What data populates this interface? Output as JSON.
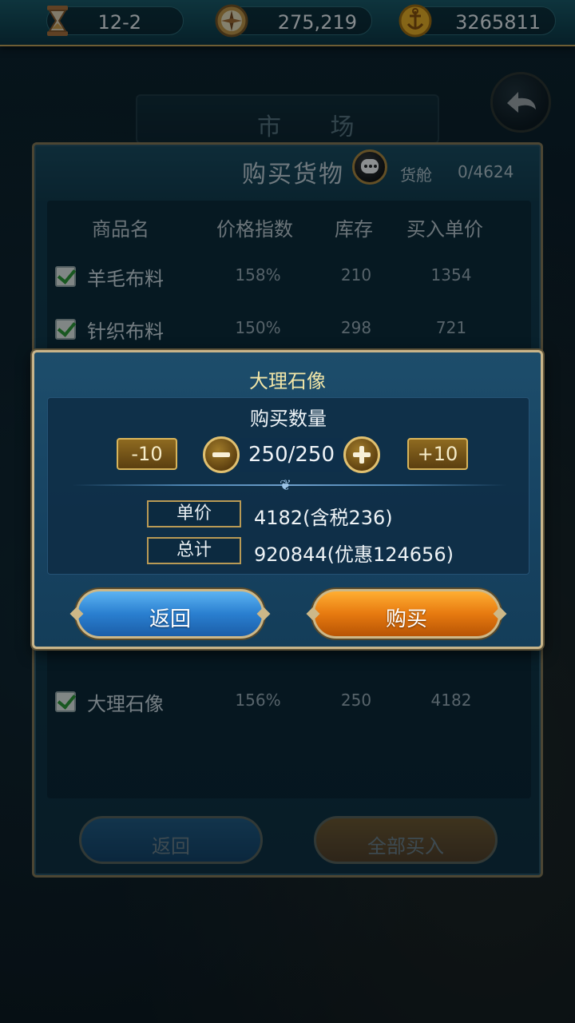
{
  "status_bar": {
    "date": "12-2",
    "fame": "275,219",
    "gold": "3265811",
    "icons": [
      "hourglass-icon",
      "compass-icon",
      "gold-anchor-coin-icon"
    ]
  },
  "background": {
    "market_title": "市 场",
    "panel_title": "购买货物",
    "hold_label": "货舱",
    "hold_value": "0/4624",
    "columns": [
      "商品名",
      "价格指数",
      "库存",
      "买入单价"
    ],
    "rows": [
      {
        "name": "羊毛布料",
        "index": "158%",
        "stock": "210",
        "price": "1354",
        "checked": true
      },
      {
        "name": "针织布料",
        "index": "150%",
        "stock": "298",
        "price": "721",
        "checked": true
      },
      {
        "name": "大理石像",
        "index": "156%",
        "stock": "250",
        "price": "4182",
        "checked": true
      }
    ],
    "back_button": "返回",
    "buy_all_button": "全部买入"
  },
  "modal": {
    "title": "大理石像",
    "quantity_label": "购买数量",
    "minus10": "-10",
    "plus10": "+10",
    "quantity": "250/250",
    "unit_price_label": "单价",
    "unit_price_value": "4182(含税236)",
    "total_label": "总计",
    "total_value": "920844(优惠124656)",
    "back_button": "返回",
    "buy_button": "购买"
  },
  "colors": {
    "accent_gold": "#c9b58a",
    "buy_orange": "#e77a10",
    "back_blue": "#2a7fd0",
    "title_yellow": "#f2e6a8"
  }
}
